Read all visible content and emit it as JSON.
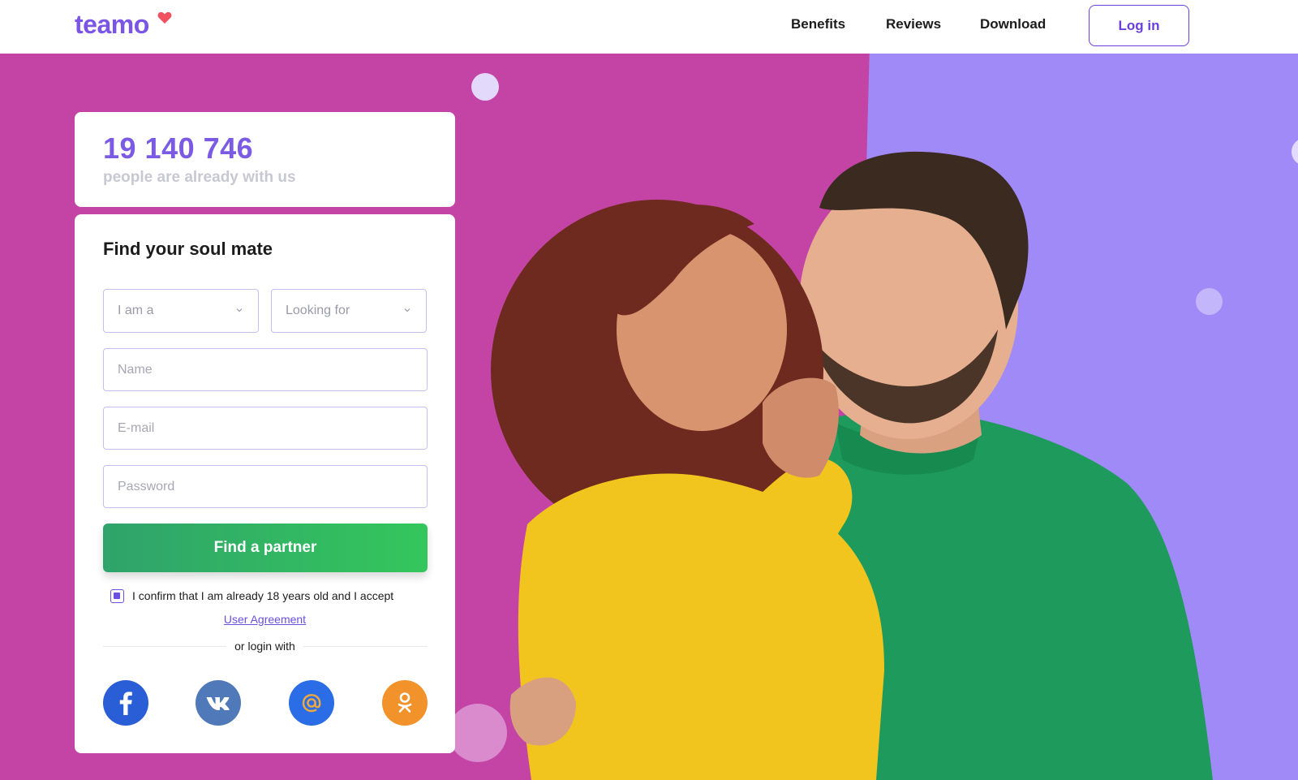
{
  "header": {
    "logo": "teamo",
    "nav": {
      "benefits": "Benefits",
      "reviews": "Reviews",
      "download": "Download"
    },
    "login_label": "Log in"
  },
  "counter": {
    "number": "19 140 746",
    "text": "people are already with us"
  },
  "form": {
    "title": "Find your soul mate",
    "select_iam": "I am a",
    "select_looking": "Looking for",
    "name_placeholder": "Name",
    "email_placeholder": "E-mail",
    "password_placeholder": "Password",
    "submit_label": "Find a partner",
    "confirm_text": "I confirm that I am already 18 years old and I accept",
    "agreement_link": "User Agreement",
    "or_login": "or login with",
    "confirm_checked": true
  },
  "social": [
    "facebook-icon",
    "vk-icon",
    "mail-ru-icon",
    "odnoklassniki-icon"
  ],
  "colors": {
    "brand": "#7a55e6",
    "hero_left": "#c444a5",
    "hero_right": "#a08af8",
    "cta": "#34c65c",
    "facebook": "#2a5ed6",
    "vk": "#4f79b8",
    "mail": "#2b6de6",
    "odnoklassniki": "#f2922a"
  }
}
